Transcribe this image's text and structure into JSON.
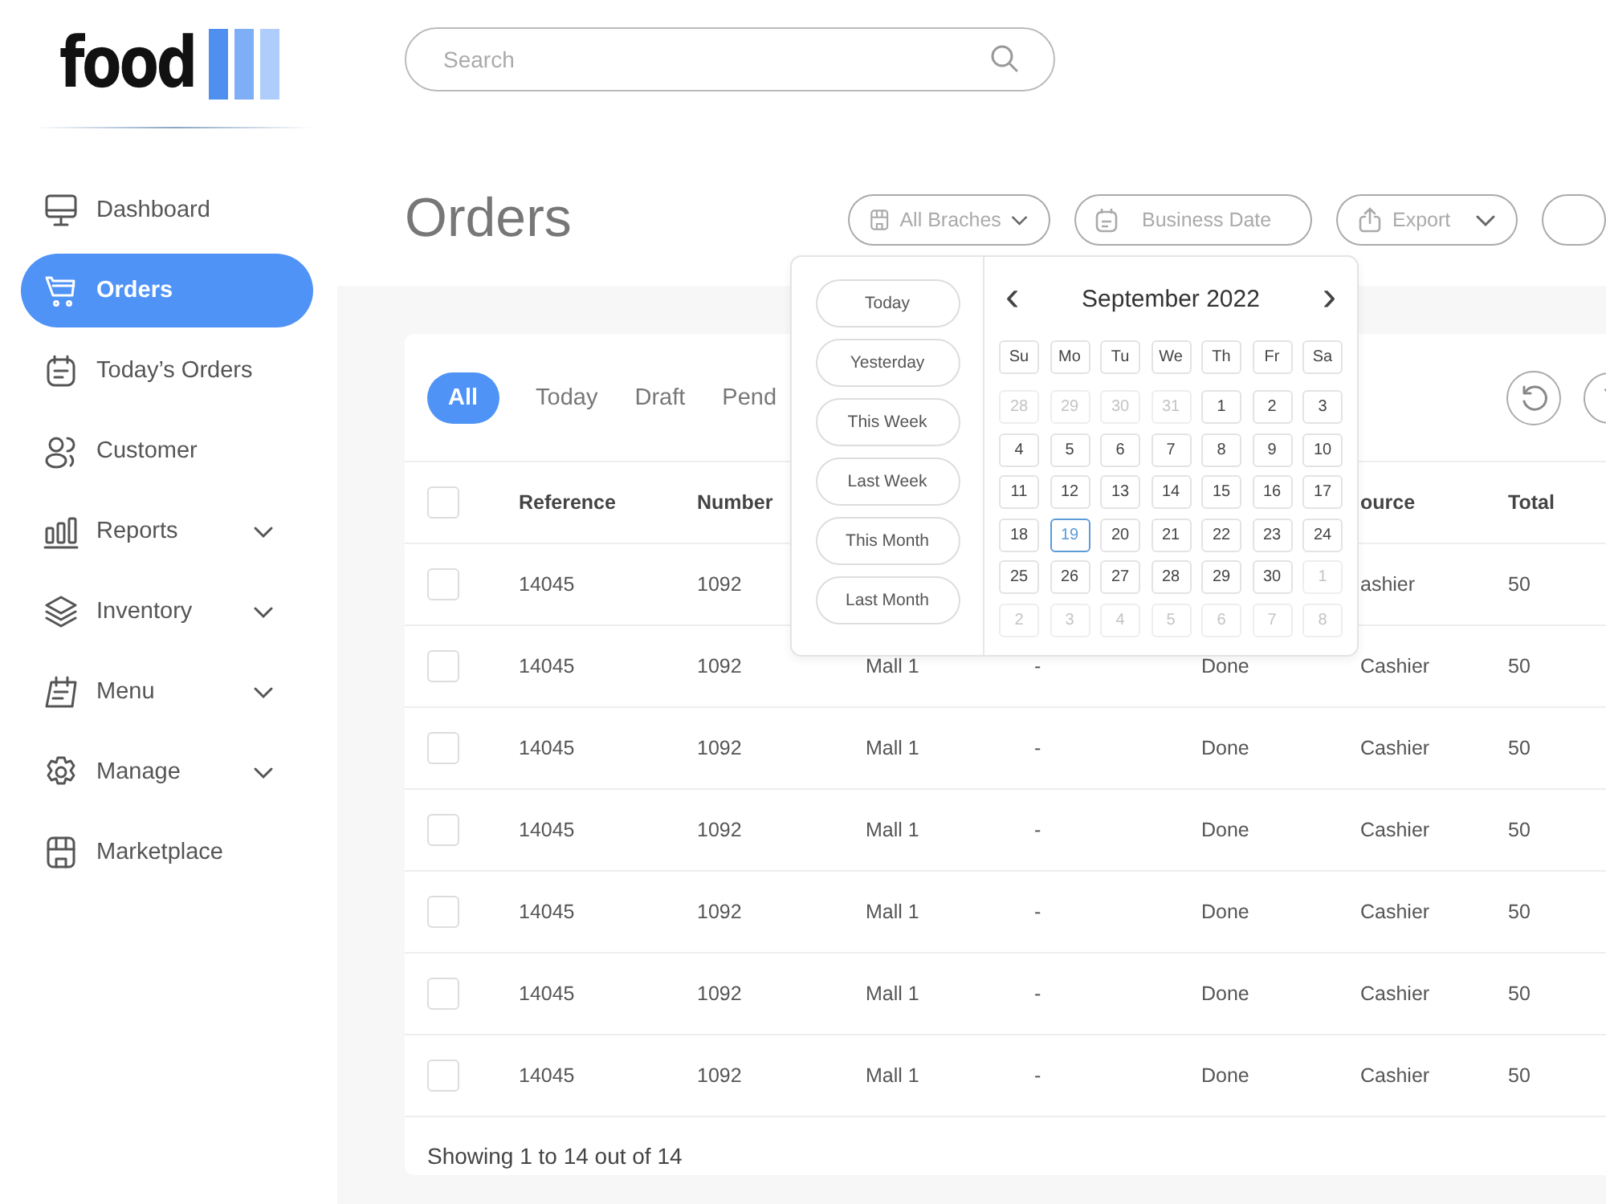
{
  "logo": {
    "text": "food"
  },
  "sidebar": {
    "items": [
      {
        "label": "Dashboard",
        "selected": false,
        "expandable": false
      },
      {
        "label": "Orders",
        "selected": true,
        "expandable": false
      },
      {
        "label": "Today’s Orders",
        "selected": false,
        "expandable": false
      },
      {
        "label": "Customer",
        "selected": false,
        "expandable": false
      },
      {
        "label": "Reports",
        "selected": false,
        "expandable": true
      },
      {
        "label": "Inventory",
        "selected": false,
        "expandable": true
      },
      {
        "label": "Menu",
        "selected": false,
        "expandable": true
      },
      {
        "label": "Manage",
        "selected": false,
        "expandable": true
      },
      {
        "label": "Marketplace",
        "selected": false,
        "expandable": false
      }
    ]
  },
  "search": {
    "placeholder": "Search"
  },
  "page_title": "Orders",
  "toolbar": {
    "branches": "All Braches",
    "date": {
      "placeholder": "Business Date"
    },
    "export": "Export"
  },
  "tabs": [
    {
      "label": "All",
      "selected": true
    },
    {
      "label": "Today",
      "selected": false
    },
    {
      "label": "Draft",
      "selected": false
    },
    {
      "label": "Pend",
      "selected": false
    }
  ],
  "table": {
    "select_all_checked": false,
    "columns": {
      "reference": "Reference",
      "number": "Number",
      "column_6": "ource",
      "total": "Total"
    },
    "rows": [
      {
        "checked": false,
        "reference": "14045",
        "number": "1092",
        "column_6": "ashier",
        "total": "50"
      },
      {
        "checked": false,
        "reference": "14045",
        "number": "1092",
        "column_3": "Mall 1",
        "column_4": "-",
        "column_5": "Done",
        "column_6": "Cashier",
        "total": "50"
      },
      {
        "checked": false,
        "reference": "14045",
        "number": "1092",
        "column_3": "Mall 1",
        "column_4": "-",
        "column_5": "Done",
        "column_6": "Cashier",
        "total": "50"
      },
      {
        "checked": false,
        "reference": "14045",
        "number": "1092",
        "column_3": "Mall 1",
        "column_4": "-",
        "column_5": "Done",
        "column_6": "Cashier",
        "total": "50"
      },
      {
        "checked": false,
        "reference": "14045",
        "number": "1092",
        "column_3": "Mall 1",
        "column_4": "-",
        "column_5": "Done",
        "column_6": "Cashier",
        "total": "50"
      },
      {
        "checked": false,
        "reference": "14045",
        "number": "1092",
        "column_3": "Mall 1",
        "column_4": "-",
        "column_5": "Done",
        "column_6": "Cashier",
        "total": "50"
      },
      {
        "checked": false,
        "reference": "14045",
        "number": "1092",
        "column_3": "Mall 1",
        "column_4": "-",
        "column_5": "Done",
        "column_6": "Cashier",
        "total": "50"
      }
    ],
    "footer": "Showing 1 to 14 out of 14"
  },
  "date_picker": {
    "presets": [
      "Today",
      "Yesterday",
      "This Week",
      "Last Week",
      "This Month",
      "Last Month"
    ],
    "month": "September 2022",
    "prev": "‹",
    "next": "›",
    "weekdays": [
      "Su",
      "Mo",
      "Tu",
      "We",
      "Th",
      "Fr",
      "Sa"
    ],
    "days": [
      {
        "label": "28",
        "outside": true,
        "selected": false
      },
      {
        "label": "29",
        "outside": true,
        "selected": false
      },
      {
        "label": "30",
        "outside": true,
        "selected": false
      },
      {
        "label": "31",
        "outside": true,
        "selected": false
      },
      {
        "label": "1",
        "outside": false,
        "selected": false
      },
      {
        "label": "2",
        "outside": false,
        "selected": false
      },
      {
        "label": "3",
        "outside": false,
        "selected": false
      },
      {
        "label": "4",
        "outside": false,
        "selected": false
      },
      {
        "label": "5",
        "outside": false,
        "selected": false
      },
      {
        "label": "6",
        "outside": false,
        "selected": false
      },
      {
        "label": "7",
        "outside": false,
        "selected": false
      },
      {
        "label": "8",
        "outside": false,
        "selected": false
      },
      {
        "label": "9",
        "outside": false,
        "selected": false
      },
      {
        "label": "10",
        "outside": false,
        "selected": false
      },
      {
        "label": "11",
        "outside": false,
        "selected": false
      },
      {
        "label": "12",
        "outside": false,
        "selected": false
      },
      {
        "label": "13",
        "outside": false,
        "selected": false
      },
      {
        "label": "14",
        "outside": false,
        "selected": false
      },
      {
        "label": "15",
        "outside": false,
        "selected": false
      },
      {
        "label": "16",
        "outside": false,
        "selected": false
      },
      {
        "label": "17",
        "outside": false,
        "selected": false
      },
      {
        "label": "18",
        "outside": false,
        "selected": false
      },
      {
        "label": "19",
        "outside": false,
        "selected": true
      },
      {
        "label": "20",
        "outside": false,
        "selected": false
      },
      {
        "label": "21",
        "outside": false,
        "selected": false
      },
      {
        "label": "22",
        "outside": false,
        "selected": false
      },
      {
        "label": "23",
        "outside": false,
        "selected": false
      },
      {
        "label": "24",
        "outside": false,
        "selected": false
      },
      {
        "label": "25",
        "outside": false,
        "selected": false
      },
      {
        "label": "26",
        "outside": false,
        "selected": false
      },
      {
        "label": "27",
        "outside": false,
        "selected": false
      },
      {
        "label": "28",
        "outside": false,
        "selected": false
      },
      {
        "label": "29",
        "outside": false,
        "selected": false
      },
      {
        "label": "30",
        "outside": false,
        "selected": false
      },
      {
        "label": "1",
        "outside": true,
        "selected": false
      },
      {
        "label": "2",
        "outside": true,
        "selected": false
      },
      {
        "label": "3",
        "outside": true,
        "selected": false
      },
      {
        "label": "4",
        "outside": true,
        "selected": false
      },
      {
        "label": "5",
        "outside": true,
        "selected": false
      },
      {
        "label": "6",
        "outside": true,
        "selected": false
      },
      {
        "label": "7",
        "outside": true,
        "selected": false
      },
      {
        "label": "8",
        "outside": true,
        "selected": false
      }
    ]
  }
}
